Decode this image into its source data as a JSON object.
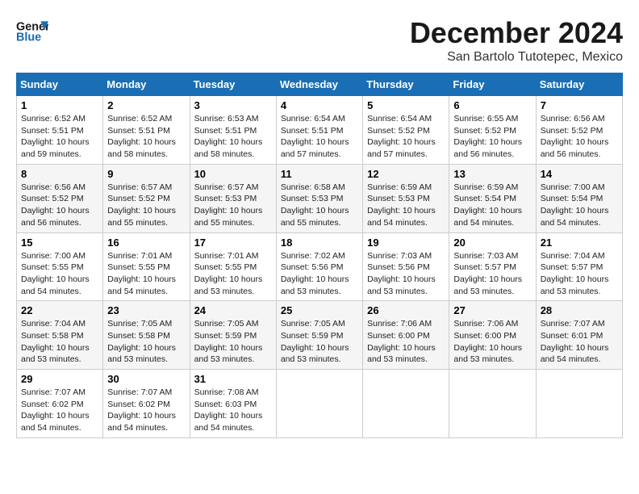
{
  "logo": {
    "line1": "General",
    "line2": "Blue"
  },
  "title": "December 2024",
  "location": "San Bartolo Tutotepec, Mexico",
  "days_of_week": [
    "Sunday",
    "Monday",
    "Tuesday",
    "Wednesday",
    "Thursday",
    "Friday",
    "Saturday"
  ],
  "weeks": [
    [
      {
        "day": "1",
        "sunrise": "6:52 AM",
        "sunset": "5:51 PM",
        "daylight": "10 hours and 59 minutes."
      },
      {
        "day": "2",
        "sunrise": "6:52 AM",
        "sunset": "5:51 PM",
        "daylight": "10 hours and 58 minutes."
      },
      {
        "day": "3",
        "sunrise": "6:53 AM",
        "sunset": "5:51 PM",
        "daylight": "10 hours and 58 minutes."
      },
      {
        "day": "4",
        "sunrise": "6:54 AM",
        "sunset": "5:51 PM",
        "daylight": "10 hours and 57 minutes."
      },
      {
        "day": "5",
        "sunrise": "6:54 AM",
        "sunset": "5:52 PM",
        "daylight": "10 hours and 57 minutes."
      },
      {
        "day": "6",
        "sunrise": "6:55 AM",
        "sunset": "5:52 PM",
        "daylight": "10 hours and 56 minutes."
      },
      {
        "day": "7",
        "sunrise": "6:56 AM",
        "sunset": "5:52 PM",
        "daylight": "10 hours and 56 minutes."
      }
    ],
    [
      {
        "day": "8",
        "sunrise": "6:56 AM",
        "sunset": "5:52 PM",
        "daylight": "10 hours and 56 minutes."
      },
      {
        "day": "9",
        "sunrise": "6:57 AM",
        "sunset": "5:52 PM",
        "daylight": "10 hours and 55 minutes."
      },
      {
        "day": "10",
        "sunrise": "6:57 AM",
        "sunset": "5:53 PM",
        "daylight": "10 hours and 55 minutes."
      },
      {
        "day": "11",
        "sunrise": "6:58 AM",
        "sunset": "5:53 PM",
        "daylight": "10 hours and 55 minutes."
      },
      {
        "day": "12",
        "sunrise": "6:59 AM",
        "sunset": "5:53 PM",
        "daylight": "10 hours and 54 minutes."
      },
      {
        "day": "13",
        "sunrise": "6:59 AM",
        "sunset": "5:54 PM",
        "daylight": "10 hours and 54 minutes."
      },
      {
        "day": "14",
        "sunrise": "7:00 AM",
        "sunset": "5:54 PM",
        "daylight": "10 hours and 54 minutes."
      }
    ],
    [
      {
        "day": "15",
        "sunrise": "7:00 AM",
        "sunset": "5:55 PM",
        "daylight": "10 hours and 54 minutes."
      },
      {
        "day": "16",
        "sunrise": "7:01 AM",
        "sunset": "5:55 PM",
        "daylight": "10 hours and 54 minutes."
      },
      {
        "day": "17",
        "sunrise": "7:01 AM",
        "sunset": "5:55 PM",
        "daylight": "10 hours and 53 minutes."
      },
      {
        "day": "18",
        "sunrise": "7:02 AM",
        "sunset": "5:56 PM",
        "daylight": "10 hours and 53 minutes."
      },
      {
        "day": "19",
        "sunrise": "7:03 AM",
        "sunset": "5:56 PM",
        "daylight": "10 hours and 53 minutes."
      },
      {
        "day": "20",
        "sunrise": "7:03 AM",
        "sunset": "5:57 PM",
        "daylight": "10 hours and 53 minutes."
      },
      {
        "day": "21",
        "sunrise": "7:04 AM",
        "sunset": "5:57 PM",
        "daylight": "10 hours and 53 minutes."
      }
    ],
    [
      {
        "day": "22",
        "sunrise": "7:04 AM",
        "sunset": "5:58 PM",
        "daylight": "10 hours and 53 minutes."
      },
      {
        "day": "23",
        "sunrise": "7:05 AM",
        "sunset": "5:58 PM",
        "daylight": "10 hours and 53 minutes."
      },
      {
        "day": "24",
        "sunrise": "7:05 AM",
        "sunset": "5:59 PM",
        "daylight": "10 hours and 53 minutes."
      },
      {
        "day": "25",
        "sunrise": "7:05 AM",
        "sunset": "5:59 PM",
        "daylight": "10 hours and 53 minutes."
      },
      {
        "day": "26",
        "sunrise": "7:06 AM",
        "sunset": "6:00 PM",
        "daylight": "10 hours and 53 minutes."
      },
      {
        "day": "27",
        "sunrise": "7:06 AM",
        "sunset": "6:00 PM",
        "daylight": "10 hours and 53 minutes."
      },
      {
        "day": "28",
        "sunrise": "7:07 AM",
        "sunset": "6:01 PM",
        "daylight": "10 hours and 54 minutes."
      }
    ],
    [
      {
        "day": "29",
        "sunrise": "7:07 AM",
        "sunset": "6:02 PM",
        "daylight": "10 hours and 54 minutes."
      },
      {
        "day": "30",
        "sunrise": "7:07 AM",
        "sunset": "6:02 PM",
        "daylight": "10 hours and 54 minutes."
      },
      {
        "day": "31",
        "sunrise": "7:08 AM",
        "sunset": "6:03 PM",
        "daylight": "10 hours and 54 minutes."
      },
      null,
      null,
      null,
      null
    ]
  ]
}
